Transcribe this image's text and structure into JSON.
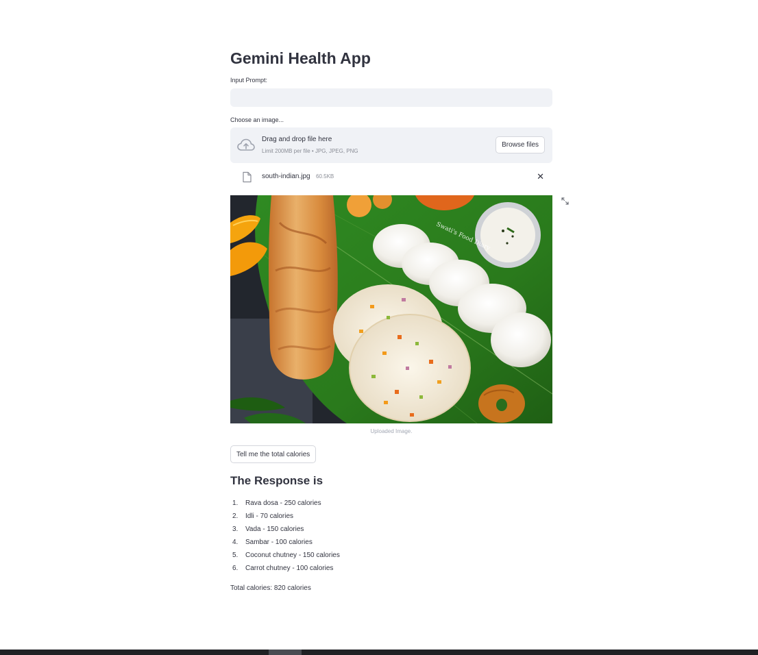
{
  "app": {
    "title": "Gemini Health App"
  },
  "prompt": {
    "label": "Input Prompt:",
    "value": "",
    "placeholder": ""
  },
  "uploader": {
    "label": "Choose an image...",
    "drop_text": "Drag and drop file here",
    "limit_text": "Limit 200MB per file • JPG, JPEG, PNG",
    "browse_label": "Browse files",
    "icon": "cloud-upload-icon"
  },
  "file": {
    "name": "south-indian.jpg",
    "size": "60.5KB",
    "close_glyph": "✕",
    "icon": "file-icon"
  },
  "image": {
    "caption": "Uploaded Image.",
    "watermark": "Swati's Food Diary"
  },
  "action": {
    "label": "Tell me the total calories"
  },
  "response": {
    "title": "The Response is",
    "items": [
      {
        "num": "1.",
        "text": "Rava dosa - 250 calories"
      },
      {
        "num": "2.",
        "text": "Idli - 70 calories"
      },
      {
        "num": "3.",
        "text": "Vada - 150 calories"
      },
      {
        "num": "4.",
        "text": "Sambar - 100 calories"
      },
      {
        "num": "5.",
        "text": "Coconut chutney - 150 calories"
      },
      {
        "num": "6.",
        "text": "Carrot chutney - 100 calories"
      }
    ],
    "total": "Total calories: 820 calories"
  },
  "colors": {
    "input_bg": "#f0f2f6",
    "text": "#31333f",
    "muted": "#8a8d96",
    "banana_leaf": "#2f7d1f"
  }
}
